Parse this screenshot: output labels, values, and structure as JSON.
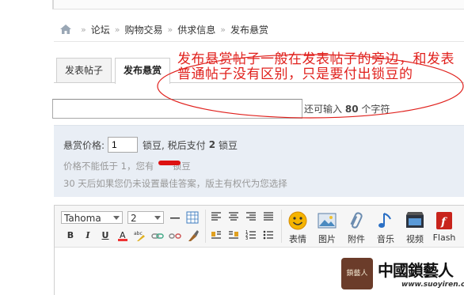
{
  "breadcrumb": {
    "items": [
      "论坛",
      "购物交易",
      "供求信息",
      "发布悬赏"
    ],
    "separator": "»"
  },
  "tabs": [
    {
      "label": "发表帖子"
    },
    {
      "label": "发布悬赏",
      "active": true
    }
  ],
  "title_input": {
    "value": ""
  },
  "char_hint": {
    "prefix": "还可输入",
    "count": "80",
    "suffix": "个字符"
  },
  "reward": {
    "label": "悬赏价格:",
    "value": "1",
    "unit_text": "锁豆, 税后支付",
    "after_tax": "2",
    "after_unit": "锁豆",
    "min_note": "价格不能低于 1，您有",
    "min_note_tail": "锁豆",
    "rule_note": "30 天后如果您仍未设置最佳答案，版主有权代为您选择"
  },
  "editor": {
    "font_family": "Tahoma",
    "font_size": "2",
    "buttons": [
      "表情",
      "图片",
      "附件",
      "音乐",
      "视频",
      "Flash"
    ]
  },
  "annotation": {
    "text": "发布悬赏帖子一般在发表帖子的旁边，和发表普通帖子没有区别，只是要付出锁豆的",
    "color": "#e0201c"
  },
  "watermark": {
    "title": "中國鎖藝人",
    "url": "www.suoyiren.com",
    "seal": "鎖藝人"
  },
  "colors": {
    "panel_bg": "#e9eef5",
    "annotation": "#e0201c"
  }
}
